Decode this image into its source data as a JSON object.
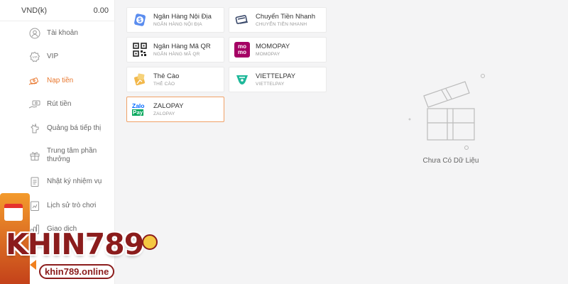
{
  "balance": {
    "currency": "VND(k)",
    "amount": "0.00"
  },
  "sidebar": {
    "items": [
      {
        "label": "Tài khoản",
        "icon": "user-icon"
      },
      {
        "label": "VIP",
        "icon": "vip-icon"
      },
      {
        "label": "Nạp tiền",
        "icon": "deposit-icon",
        "active": true
      },
      {
        "label": "Rút tiền",
        "icon": "withdraw-icon"
      },
      {
        "label": "Quảng bá tiếp thị",
        "icon": "promote-icon"
      },
      {
        "label": "Trung tâm phần thưởng",
        "icon": "gift-icon"
      },
      {
        "label": "Nhật ký nhiệm vụ",
        "icon": "tasklog-icon"
      },
      {
        "label": "Lịch sử trò chơi",
        "icon": "history-icon"
      },
      {
        "label": "Giao dịch",
        "icon": "transaction-icon"
      }
    ]
  },
  "methods": [
    {
      "name": "Ngân Hàng Nội Địa",
      "sub": "NGÂN HÀNG NỘI ĐỊA",
      "icon": "local-bank-icon"
    },
    {
      "name": "Chuyển Tiền Nhanh",
      "sub": "CHUYỂN TIỀN NHANH",
      "icon": "fast-transfer-icon"
    },
    {
      "name": "Ngân Hàng Mã QR",
      "sub": "NGÂN HÀNG MÃ QR",
      "icon": "qr-code-icon"
    },
    {
      "name": "MOMOPAY",
      "sub": "MOMOPAY",
      "icon": "momo-icon"
    },
    {
      "name": "Thẻ Cào",
      "sub": "THẺ CÀO",
      "icon": "scratch-card-icon"
    },
    {
      "name": "VIETTELPAY",
      "sub": "VIETTELPAY",
      "icon": "viettelpay-icon"
    },
    {
      "name": "ZALOPAY",
      "sub": "ZALOPAY",
      "icon": "zalopay-icon",
      "selected": true
    }
  ],
  "empty_state": {
    "text": "Chưa Có Dữ Liệu"
  },
  "watermark": {
    "brand": "KHIN789",
    "url": "khin789.online"
  },
  "colors": {
    "accent": "#e8772e",
    "selected_border": "#f0a167",
    "momo": "#a50064",
    "zalo": "#0068ff"
  },
  "logo_text": {
    "momo_top": "mo",
    "momo_bottom": "mo",
    "zalo_top": "Zalo",
    "zalo_bottom": "Pay"
  }
}
